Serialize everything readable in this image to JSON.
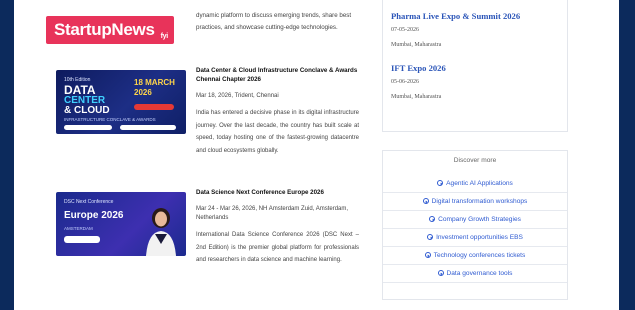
{
  "brand": {
    "logo_text": "StartupNews",
    "logo_tm": "fyi",
    "accent": "#e8335a"
  },
  "intro_text": "dynamic platform to discuss emerging trends, share best practices, and showcase cutting-edge technologies.",
  "events": [
    {
      "title": "Data Center & Cloud Infrastructure Conclave & Awards Chennai Chapter 2026",
      "meta": "Mar 18, 2026, Trident, Chennai",
      "description": "India has entered a decisive phase in its digital infrastructure journey. Over the last decade, the country has built scale at speed, today hosting one of the fastest-growing datacentre and cloud ecosystems globally.",
      "thumb": {
        "tag": "10th Edition",
        "line1": "DATA",
        "line2": "CENTER",
        "line3": "& CLOUD",
        "sub": "INFRASTRUCTURE CONCLAVE & AWARDS",
        "date": "18 MARCH 2026"
      }
    },
    {
      "title": "Data Science Next Conference Europe 2026",
      "meta": "Mar 24 - Mar 26, 2026, NH Amsterdam Zuid, Amsterdam, Netherlands",
      "description": "International Data Science Conference 2026 (DSC Next – 2nd Edition) is the premier global platform for professionals and researchers in data science and machine learning.",
      "thumb": {
        "tag": "DSC Next Conference",
        "line1": "Europe 2026",
        "sub": "AMSTERDAM"
      }
    }
  ],
  "expos": [
    {
      "title": "Pharma Live Expo & Summit 2026",
      "date": "07-05-2026",
      "location": "Mumbai, Maharastra"
    },
    {
      "title": "IFT Expo 2026",
      "date": "05-06-2026",
      "location": "Mumbai, Maharastra"
    }
  ],
  "discover": {
    "title": "Discover more",
    "link_color": "#2f5bd1",
    "links": [
      "Agentic AI Applications",
      "Digital transformation workshops",
      "Company Growth Strategies",
      "Investment opportunities EBS",
      "Technology conferences tickets",
      "Data governance tools"
    ]
  }
}
